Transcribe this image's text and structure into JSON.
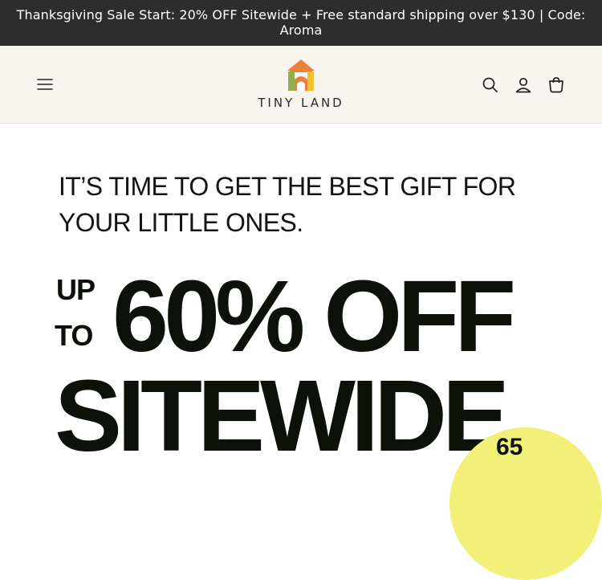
{
  "announcement": {
    "text": "Thanksgiving Sale Start: 20% OFF Sitewide + Free standard shipping over $130 | Code: Aroma"
  },
  "header": {
    "brand": "TINY LAND",
    "menu_icon": "menu-icon",
    "search_icon": "search-icon",
    "account_icon": "account-icon",
    "cart_icon": "cart-icon",
    "colors": {
      "bg": "#f8f4f0",
      "logo_orange": "#e8823a",
      "logo_green": "#8fb04a",
      "logo_yellow": "#f0c232"
    }
  },
  "hero": {
    "subtitle": "IT’S TIME TO GET THE BEST GIFT FOR YOUR LITTLE ONES.",
    "up": "UP",
    "to": "TO",
    "headline_percent": "60% OFF",
    "headline_sitewide": "SITEWIDE",
    "badge_text": "65",
    "badge_color": "#f3f07a"
  }
}
